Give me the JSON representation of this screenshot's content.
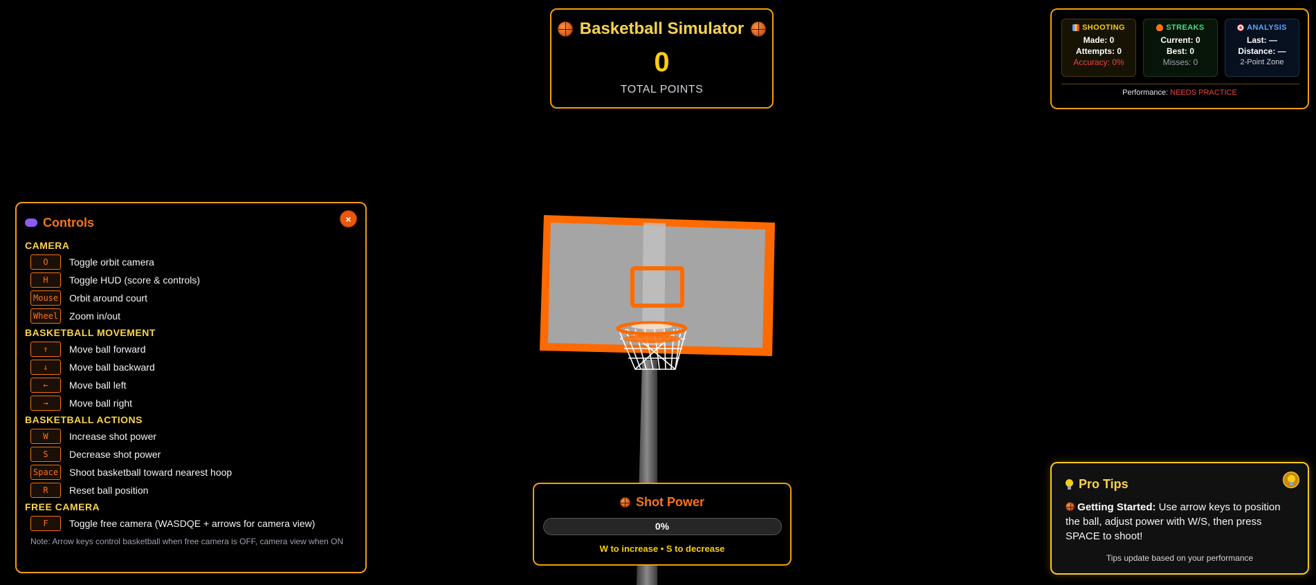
{
  "scoreboard": {
    "title": "Basketball Simulator",
    "points": "0",
    "points_label": "TOTAL POINTS"
  },
  "stats": {
    "shooting": {
      "header": "SHOOTING",
      "made": "Made: 0",
      "attempts": "Attempts: 0",
      "accuracy": "Accuracy: 0%"
    },
    "streaks": {
      "header": "STREAKS",
      "current": "Current: 0",
      "best": "Best: 0",
      "misses": "Misses: 0"
    },
    "analysis": {
      "header": "ANALYSIS",
      "last": "Last: —",
      "distance": "Distance: —",
      "zone": "2-Point Zone"
    },
    "performance_label": "Performance:",
    "performance_value": "NEEDS PRACTICE"
  },
  "controls": {
    "title": "Controls",
    "close_label": "×",
    "sections": [
      {
        "title": "CAMERA",
        "items": [
          {
            "key": "O",
            "desc": "Toggle orbit camera"
          },
          {
            "key": "H",
            "desc": "Toggle HUD (score & controls)"
          },
          {
            "key": "Mouse",
            "desc": "Orbit around court"
          },
          {
            "key": "Wheel",
            "desc": "Zoom in/out"
          }
        ]
      },
      {
        "title": "BASKETBALL MOVEMENT",
        "items": [
          {
            "key": "↑",
            "desc": "Move ball forward"
          },
          {
            "key": "↓",
            "desc": "Move ball backward"
          },
          {
            "key": "←",
            "desc": "Move ball left"
          },
          {
            "key": "→",
            "desc": "Move ball right"
          }
        ]
      },
      {
        "title": "BASKETBALL ACTIONS",
        "items": [
          {
            "key": "W",
            "desc": "Increase shot power"
          },
          {
            "key": "S",
            "desc": "Decrease shot power"
          },
          {
            "key": "Space",
            "desc": "Shoot basketball toward nearest hoop"
          },
          {
            "key": "R",
            "desc": "Reset ball position"
          }
        ]
      },
      {
        "title": "FREE CAMERA",
        "items": [
          {
            "key": "F",
            "desc": "Toggle free camera (WASDQE + arrows for camera view)"
          }
        ]
      }
    ],
    "note": "Note: Arrow keys control basketball when free camera is OFF, camera view when ON"
  },
  "power": {
    "title": "Shot Power",
    "value": 0,
    "percent_label": "0%",
    "hint": "W to increase • S to decrease"
  },
  "tips": {
    "title": "Pro Tips",
    "lead": "Getting Started:",
    "text": " Use arrow keys to position the ball, adjust power with W/S, then press SPACE to shoot!",
    "footer": "Tips update based on your performance"
  },
  "colors": {
    "accent": "#f59e0b",
    "orange": "#f97316",
    "gold": "#facc15",
    "danger": "#ef4444"
  }
}
